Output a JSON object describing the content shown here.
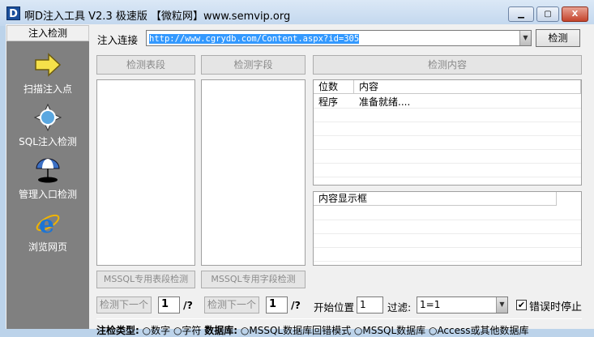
{
  "window": {
    "title": "啊D注入工具 V2.3  极速版 【微粒网】www.semvip.org",
    "app_icon_letter": "D"
  },
  "sidebar": {
    "tab": "注入检测",
    "items": [
      {
        "label": "扫描注入点",
        "icon": "arrow-right-icon"
      },
      {
        "label": "SQL注入检测",
        "icon": "compass-icon"
      },
      {
        "label": "管理入口检测",
        "icon": "umbrella-icon"
      },
      {
        "label": "浏览网页",
        "icon": "ie-icon"
      }
    ]
  },
  "url_bar": {
    "label": "注入连接",
    "value": "http://www.cgrydb.com/Content.aspx?id=305",
    "button": "检测"
  },
  "buttons": {
    "detect_tables": "检测表段",
    "detect_fields": "检测字段",
    "detect_content": "检测内容",
    "mssql_tables": "MSSQL专用表段检测",
    "mssql_fields": "MSSQL专用字段检测",
    "next1": "检测下一个",
    "next2": "检测下一个"
  },
  "result_grid": {
    "columns": [
      "位数",
      "内容"
    ],
    "rows": [
      [
        "程序",
        "准备就绪...."
      ]
    ]
  },
  "content_grid": {
    "header": "内容显示框"
  },
  "controls": {
    "next1_value": "1",
    "next1_suffix": "/?",
    "next2_value": "1",
    "next2_suffix": "/?",
    "start_label": "开始位置",
    "start_value": "1",
    "filter_label": "过滤:",
    "filter_value": "1=1",
    "stop_on_error_label": "错误时停止",
    "stop_on_error_checked": true
  },
  "status": {
    "type_label": "注检类型:",
    "type_num": "数字",
    "type_str": "字符",
    "db_label": "数据库:",
    "db1": "MSSQL数据库回错模式",
    "db2": "MSSQL数据库",
    "db3": "Access或其他数据库"
  }
}
